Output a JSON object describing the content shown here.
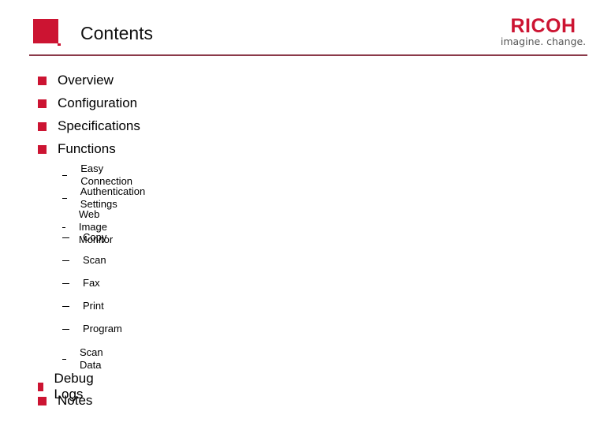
{
  "header": {
    "title": "Contents",
    "brand_name": "RICOH",
    "brand_tagline": "imagine. change.",
    "accent_color": "#cc1432"
  },
  "contents": {
    "top_items": [
      {
        "label": "Overview"
      },
      {
        "label": "Configuration"
      },
      {
        "label": "Specifications"
      },
      {
        "label": "Functions"
      }
    ],
    "function_items": [
      {
        "label": "Easy Connection"
      },
      {
        "label": "Authentication Settings"
      },
      {
        "label": "Web Image Monitor"
      },
      {
        "label": "Copy"
      },
      {
        "label": "Scan"
      },
      {
        "label": "Fax"
      },
      {
        "label": "Print"
      },
      {
        "label": "Program"
      },
      {
        "label": "Scan Data"
      }
    ],
    "bottom_items": [
      {
        "label": "Debug Logs"
      },
      {
        "label": "Notes"
      }
    ]
  }
}
